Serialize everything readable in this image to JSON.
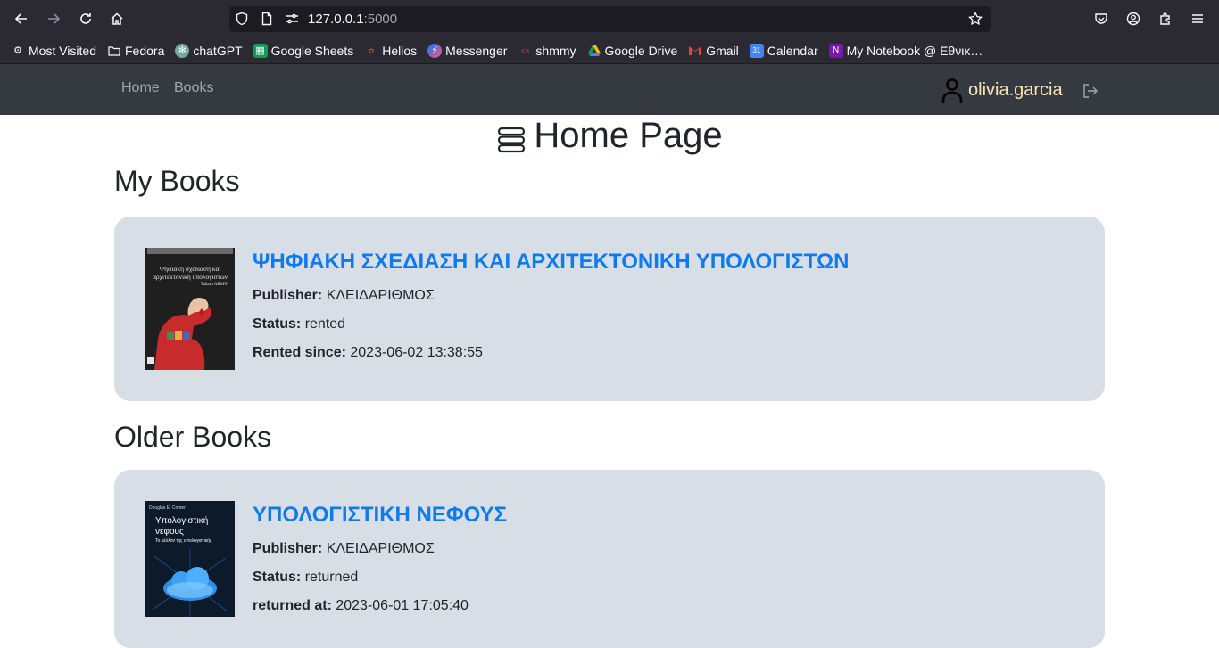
{
  "browser": {
    "url_host": "127.0.0.1",
    "url_port": ":5000",
    "bookmarks": [
      {
        "label": "Most Visited",
        "icon": "gear-icon"
      },
      {
        "label": "Fedora",
        "icon": "folder-icon"
      },
      {
        "label": "chatGPT",
        "icon": "chatgpt-icon"
      },
      {
        "label": "Google Sheets",
        "icon": "sheets-icon"
      },
      {
        "label": "Helios",
        "icon": "helios-icon"
      },
      {
        "label": "Messenger",
        "icon": "messenger-icon"
      },
      {
        "label": "shmmy",
        "icon": "shmmy-icon"
      },
      {
        "label": "Google Drive",
        "icon": "drive-icon"
      },
      {
        "label": "Gmail",
        "icon": "gmail-icon"
      },
      {
        "label": "Calendar",
        "icon": "calendar-icon"
      },
      {
        "label": "My Notebook @ Εθνικ…",
        "icon": "onenote-icon"
      }
    ]
  },
  "navbar": {
    "home": "Home",
    "books": "Books",
    "username": "olivia.garcia"
  },
  "page": {
    "title": "Home Page",
    "my_books_heading": "My Books",
    "older_books_heading": "Older Books"
  },
  "my_books": [
    {
      "title": "ΨΗΦΙΑΚΗ ΣΧΕΔΙΑΣΗ ΚΑΙ ΑΡΧΙΤΕΚΤΟΝΙΚΗ ΥΠΟΛΟΓΙΣΤΩΝ",
      "publisher_label": "Publisher:",
      "publisher": "ΚΛΕΙΔΑΡΙΘΜΟΣ",
      "status_label": "Status:",
      "status": "rented",
      "date_label": "Rented since:",
      "date": "2023-06-02 13:38:55",
      "cover_line1": "Ψηφιακή σχεδίαση και",
      "cover_line2": "αρχιτεκτονική υπολογιστών",
      "cover_line3": "Taliaro ARM®"
    }
  ],
  "older_books": [
    {
      "title": "ΥΠΟΛΟΓΙΣΤΙΚΗ ΝΕΦΟΥΣ",
      "publisher_label": "Publisher:",
      "publisher": "ΚΛΕΙΔΑΡΙΘΜΟΣ",
      "status_label": "Status:",
      "status": "returned",
      "date_label": "returned at:",
      "date": "2023-06-01 17:05:40",
      "cover_author": "Douglas E. Comer",
      "cover_line1": "Υπολογιστική",
      "cover_line2": "νέφους",
      "cover_line3": "Το μέλλον της υπολογιστικής"
    }
  ],
  "colors": {
    "link_title": "#0d7bef",
    "card_bg": "#d8dee5",
    "navbar_bg": "#343a40",
    "username": "#ffe3b3"
  }
}
